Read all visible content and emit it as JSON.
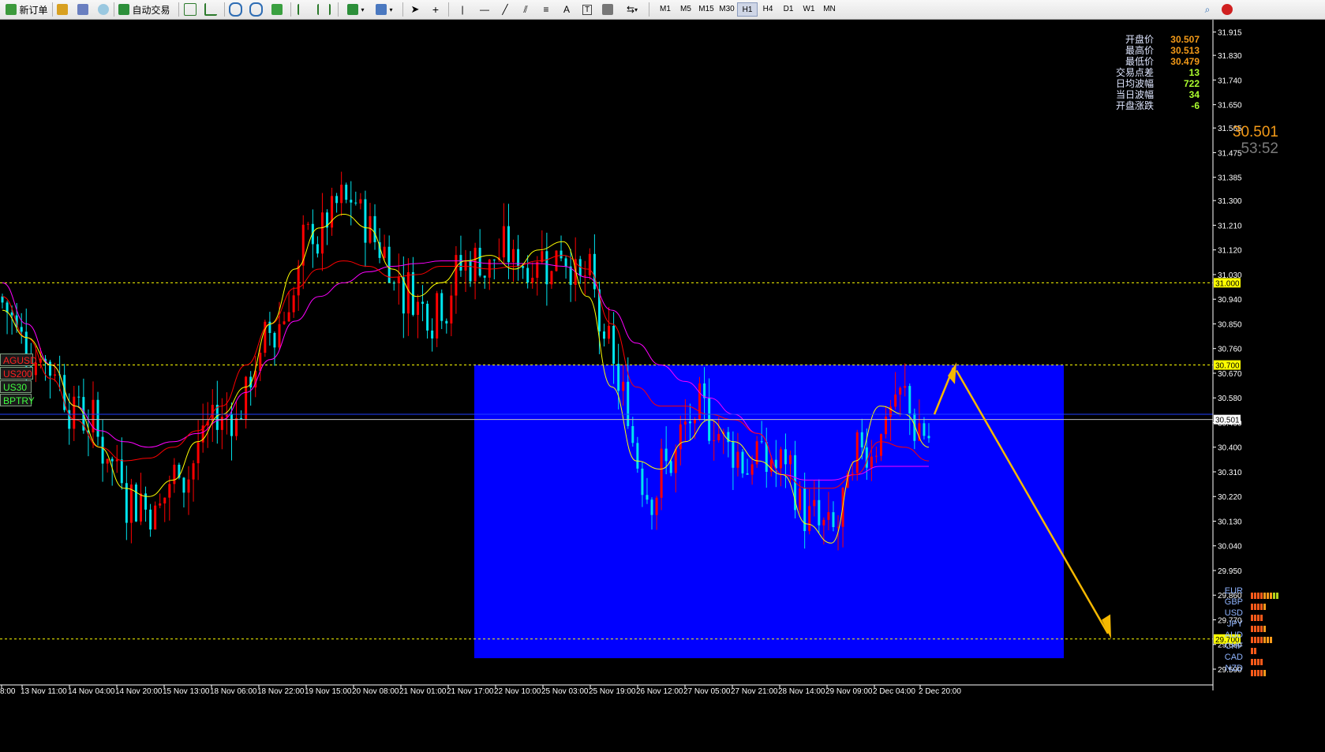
{
  "toolbar": {
    "new_order": "新订单",
    "auto_trade": "自动交易",
    "timeframes": [
      "M1",
      "M5",
      "M15",
      "M30",
      "H1",
      "H4",
      "D1",
      "W1",
      "MN"
    ],
    "active_timeframe": "H1",
    "cursor_labels": [
      "A"
    ]
  },
  "price_axis": {
    "ticks": [
      "31.915",
      "31.830",
      "31.740",
      "31.650",
      "31.565",
      "31.475",
      "31.385",
      "31.300",
      "31.210",
      "31.120",
      "31.030",
      "30.940",
      "30.850",
      "30.760",
      "30.670",
      "30.580",
      "30.490",
      "30.400",
      "30.310",
      "30.220",
      "30.130",
      "30.040",
      "29.950",
      "29.860",
      "29.770",
      "29.680",
      "29.590"
    ],
    "current_price": "30.501",
    "hlines": [
      {
        "label": "31.000",
        "value": 31.0,
        "color": "#ffff00"
      },
      {
        "label": "30.700",
        "value": 30.7,
        "color": "#ffff00"
      },
      {
        "label": "29.700",
        "value": 29.7,
        "color": "#ffff00"
      }
    ]
  },
  "time_axis": {
    "labels": [
      "8:00",
      "13 Nov 11:00",
      "14 Nov 04:00",
      "14 Nov 20:00",
      "15 Nov 13:00",
      "18 Nov 06:00",
      "18 Nov 22:00",
      "19 Nov 15:00",
      "20 Nov 08:00",
      "21 Nov 01:00",
      "21 Nov 17:00",
      "22 Nov 10:00",
      "25 Nov 03:00",
      "25 Nov 19:00",
      "26 Nov 12:00",
      "27 Nov 05:00",
      "27 Nov 21:00",
      "28 Nov 14:00",
      "29 Nov 09:00",
      "2 Dec 04:00",
      "2 Dec 20:00"
    ]
  },
  "info_panel": {
    "rows": [
      {
        "label": "开盘价",
        "value": "30.507",
        "color": "#f39a18"
      },
      {
        "label": "最高价",
        "value": "30.513",
        "color": "#f39a18"
      },
      {
        "label": "最低价",
        "value": "30.479",
        "color": "#f39a18"
      },
      {
        "label": "交易点差",
        "value": "13",
        "color": "#adff2f"
      },
      {
        "label": "日均波幅",
        "value": "722",
        "color": "#adff2f"
      },
      {
        "label": "当日波幅",
        "value": "34",
        "color": "#adff2f"
      },
      {
        "label": "开盘涨跌",
        "value": "-6",
        "color": "#adff2f"
      }
    ],
    "big_price": "30.501",
    "countdown": "53:52"
  },
  "symbol_labels": [
    {
      "text": "AGUSD",
      "color": "#ff2020"
    },
    {
      "text": "US200",
      "color": "#ff2020"
    },
    {
      "text": "US30",
      "color": "#40ff40"
    },
    {
      "text": "BPTRY",
      "color": "#40ff40"
    }
  ],
  "currency_strength": [
    {
      "name": "EUR",
      "strength": 9
    },
    {
      "name": "GBP",
      "strength": 5
    },
    {
      "name": "USD",
      "strength": 4
    },
    {
      "name": "JPY",
      "strength": 5
    },
    {
      "name": "AUD",
      "strength": 7
    },
    {
      "name": "CHF",
      "strength": 2
    },
    {
      "name": "CAD",
      "strength": 4
    },
    {
      "name": "NZD",
      "strength": 5
    }
  ],
  "colors": {
    "bull": "#ff0000",
    "bear": "#00e5ee",
    "rect": "#0000ff",
    "ma_fast": "#ffff00",
    "ma_mid": "#ff0000",
    "ma_slow": "#ff00ff",
    "arrow": "#f5b800"
  },
  "chart_data": {
    "type": "candlestick",
    "price_range": [
      29.59,
      31.96
    ],
    "ma_fast": [
      30.9,
      30.8,
      30.7,
      30.55,
      30.4,
      30.25,
      30.22,
      30.28,
      30.42,
      30.52,
      30.62,
      30.85,
      31.05,
      31.2,
      31.25,
      31.2,
      31.05,
      30.95,
      31.0,
      31.08,
      31.1,
      31.05,
      31.12,
      31.15,
      30.95,
      30.62,
      30.35,
      30.32,
      30.42,
      30.5,
      30.42,
      30.35,
      30.3,
      30.12,
      30.05,
      30.35,
      30.55,
      30.52,
      30.4
    ],
    "ma_mid": [
      30.95,
      30.8,
      30.65,
      30.5,
      30.4,
      30.35,
      30.36,
      30.4,
      30.46,
      30.55,
      30.7,
      30.85,
      30.98,
      31.05,
      31.08,
      31.06,
      31.02,
      31.03,
      31.06,
      31.06,
      31.05,
      31.06,
      31.08,
      31.1,
      31.05,
      30.85,
      30.62,
      30.55,
      30.55,
      30.52,
      30.5,
      30.45,
      30.3,
      30.25,
      30.25,
      30.3,
      30.42,
      30.4,
      30.35
    ],
    "ma_slow": [
      31.0,
      30.85,
      30.7,
      30.55,
      30.46,
      30.42,
      30.4,
      30.42,
      30.45,
      30.5,
      30.6,
      30.72,
      30.86,
      30.95,
      31.0,
      31.04,
      31.06,
      31.07,
      31.08,
      31.08,
      31.07,
      31.07,
      31.07,
      31.06,
      31.02,
      30.9,
      30.78,
      30.7,
      30.64,
      30.58,
      30.52,
      30.45,
      30.3,
      30.28,
      30.28,
      30.3,
      30.33,
      30.33,
      30.33
    ]
  }
}
